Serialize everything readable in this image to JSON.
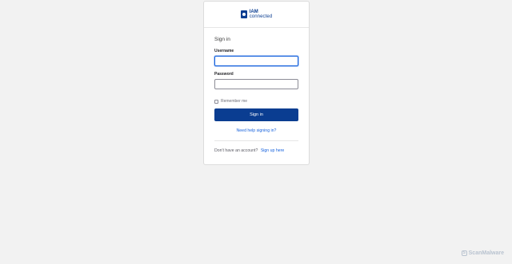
{
  "logo": {
    "line1": "IAM",
    "line2": "connected"
  },
  "form": {
    "title": "Sign in",
    "username_label": "Username",
    "username_value": "",
    "password_label": "Password",
    "password_value": "",
    "remember_label": "Remember me",
    "remember_checked": false,
    "submit_label": "Sign in",
    "help_link": "Need help signing in?",
    "no_account_text": "Don't have an account?",
    "signup_link": "Sign up here"
  },
  "watermark": {
    "icon": "S",
    "text": "ScanMalware"
  },
  "colors": {
    "brand": "#0a3d91",
    "link": "#1662dd",
    "background": "#f2f2f2"
  }
}
